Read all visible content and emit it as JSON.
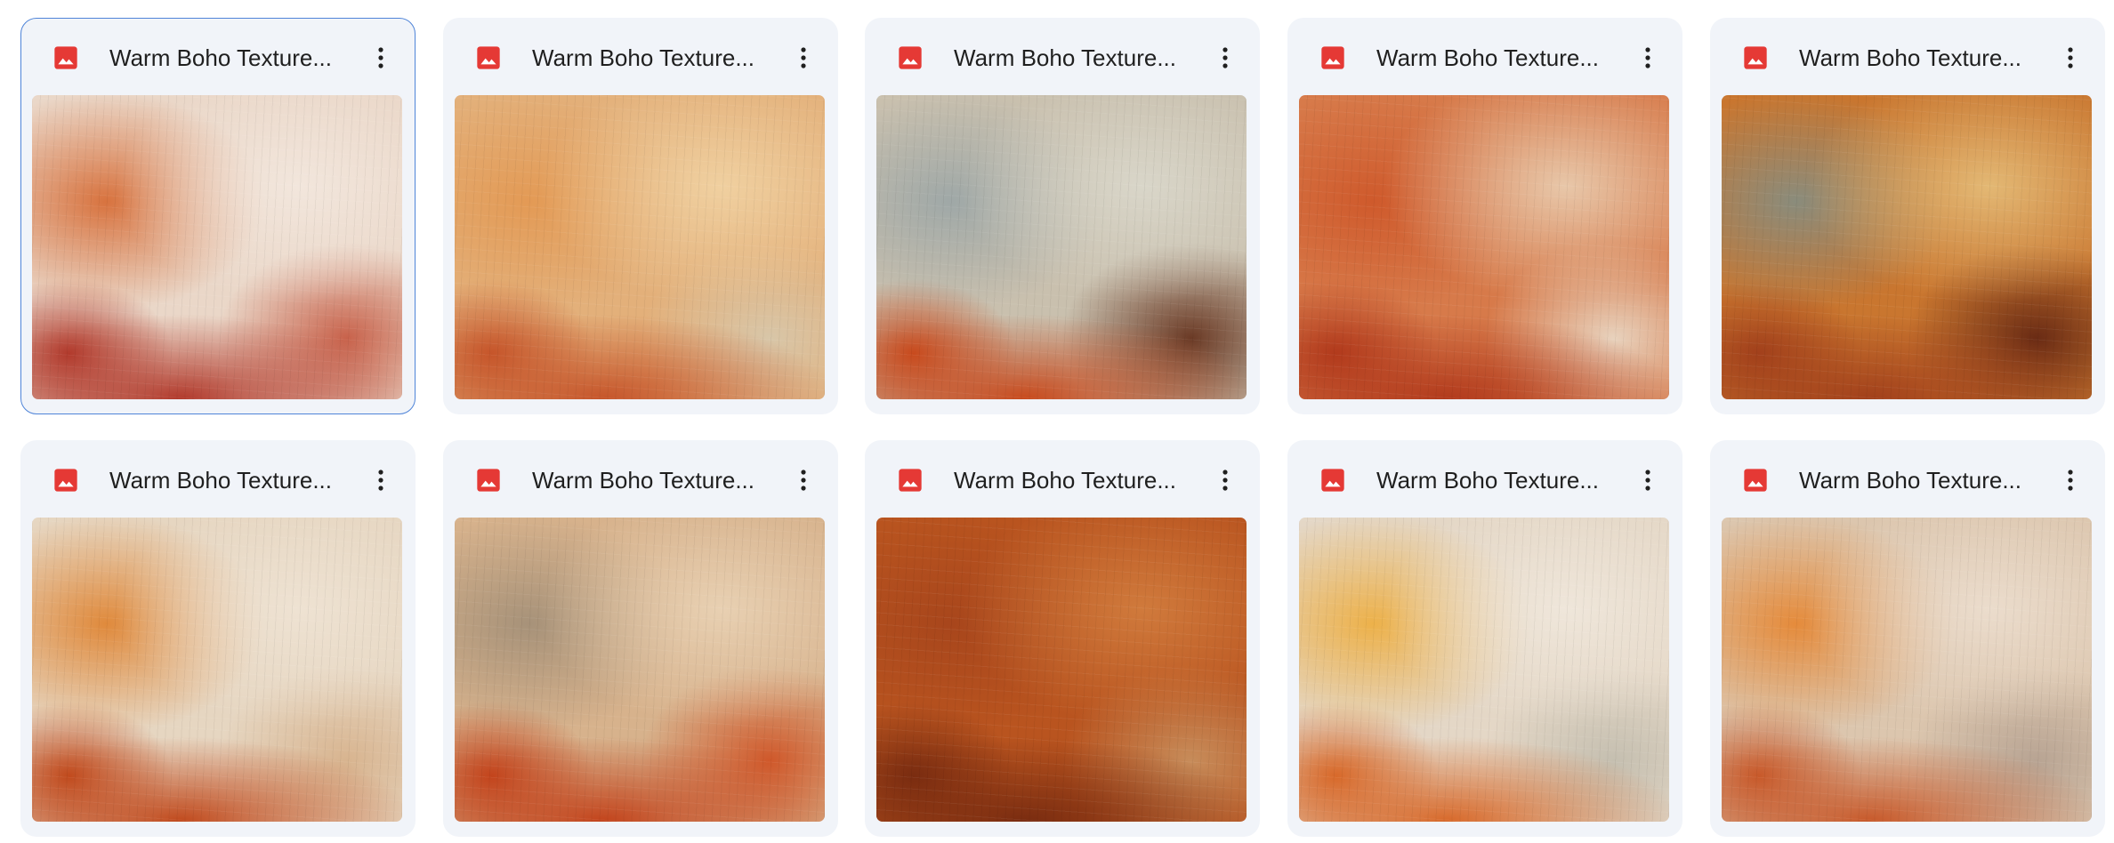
{
  "files": [
    {
      "title": "Warm Boho Texture...",
      "selected": true,
      "palette": {
        "base": "#ead7c8",
        "a": "#f2e6dc",
        "b": "#d8733f",
        "c": "#b23a2c",
        "d": "#c8624b"
      }
    },
    {
      "title": "Warm Boho Texture...",
      "selected": false,
      "palette": {
        "base": "#e3b07a",
        "a": "#f0d0a0",
        "b": "#e39a55",
        "c": "#c6552a",
        "d": "#d8c6a8"
      }
    },
    {
      "title": "Warm Boho Texture...",
      "selected": false,
      "palette": {
        "base": "#c9c0ae",
        "a": "#d9d6c9",
        "b": "#9fa8a7",
        "c": "#c84a1d",
        "d": "#6b3a25"
      }
    },
    {
      "title": "Warm Boho Texture...",
      "selected": false,
      "palette": {
        "base": "#d77a4a",
        "a": "#e8c7a9",
        "b": "#cf5a2c",
        "c": "#b23a1c",
        "d": "#e8d2bd"
      }
    },
    {
      "title": "Warm Boho Texture...",
      "selected": false,
      "palette": {
        "base": "#c9762f",
        "a": "#e3b874",
        "b": "#8a8c7c",
        "c": "#a2401b",
        "d": "#6a2b14"
      }
    },
    {
      "title": "Warm Boho Texture...",
      "selected": false,
      "palette": {
        "base": "#e6d6c1",
        "a": "#eee2d2",
        "b": "#e08a3c",
        "c": "#c14a1d",
        "d": "#d8b48f"
      }
    },
    {
      "title": "Warm Boho Texture...",
      "selected": false,
      "palette": {
        "base": "#d7b28c",
        "a": "#e8d0b2",
        "b": "#a79279",
        "c": "#c3441c",
        "d": "#d0582a"
      }
    },
    {
      "title": "Warm Boho Texture...",
      "selected": false,
      "palette": {
        "base": "#b9541f",
        "a": "#d07a3c",
        "b": "#a8461c",
        "c": "#7a2c10",
        "d": "#c78c5a"
      }
    },
    {
      "title": "Warm Boho Texture...",
      "selected": false,
      "palette": {
        "base": "#e4d7c6",
        "a": "#efe6da",
        "b": "#edb14a",
        "c": "#d8692a",
        "d": "#c5bfb0"
      }
    },
    {
      "title": "Warm Boho Texture...",
      "selected": false,
      "palette": {
        "base": "#dcc6ae",
        "a": "#ebdccc",
        "b": "#e58b3b",
        "c": "#c8592a",
        "d": "#b8a493"
      }
    }
  ],
  "icons": {
    "file_type": "image-file-icon",
    "menu": "more-vert-icon"
  },
  "colors": {
    "card_bg": "#f1f4f9",
    "selected_border": "#4f84d8",
    "image_icon": "#e53935",
    "title_text": "#1f1f1f"
  }
}
